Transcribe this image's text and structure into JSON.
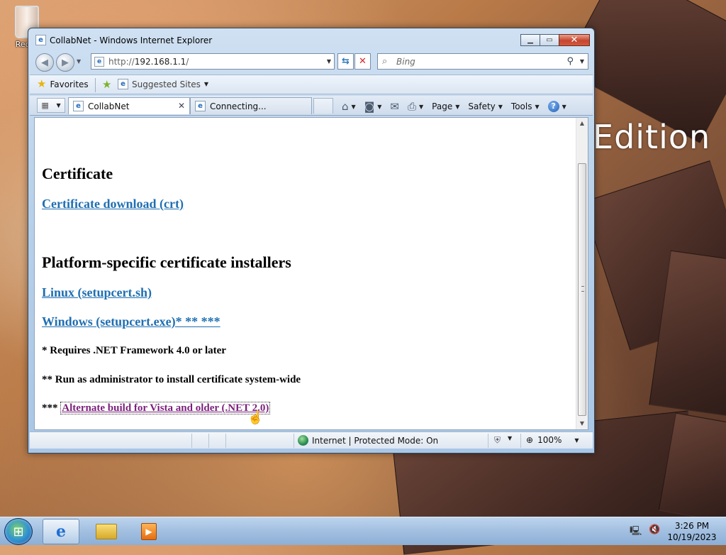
{
  "desktop": {
    "recycle_bin_label": "Recyc",
    "wallpaper_text": "Edition"
  },
  "window": {
    "title": "CollabNet - Windows Internet Explorer"
  },
  "address_bar": {
    "url_prefix": "http://",
    "url_host": "192.168.1.1",
    "url_suffix": "/"
  },
  "search": {
    "placeholder": "Bing"
  },
  "favorites_bar": {
    "favorites_label": "Favorites",
    "suggested_label": "Suggested Sites"
  },
  "tabs": [
    {
      "label": "CollabNet"
    },
    {
      "label": "Connecting..."
    }
  ],
  "command_bar": {
    "page_label": "Page",
    "safety_label": "Safety",
    "tools_label": "Tools"
  },
  "page": {
    "heading_certificate": "Certificate",
    "link_crt": "Certificate download (crt)",
    "heading_platform": "Platform-specific certificate installers",
    "link_linux": "Linux (setupcert.sh)",
    "link_windows": "Windows (setupcert.exe)* ** ***",
    "note1": "* Requires .NET Framework 4.0 or later",
    "note2": "** Run as administrator to install certificate system-wide",
    "note3_prefix": "***",
    "link_alternate": "Alternate build for Vista and older (.NET 2.0)"
  },
  "status_bar": {
    "zone_text": "Internet | Protected Mode: On",
    "zoom": "100%"
  },
  "taskbar": {
    "time": "3:26 PM",
    "date": "10/19/2023"
  },
  "colors": {
    "link": "#1f6fb2",
    "visited_link": "#7b1f7b",
    "taskbar": "#a2bfe0"
  }
}
